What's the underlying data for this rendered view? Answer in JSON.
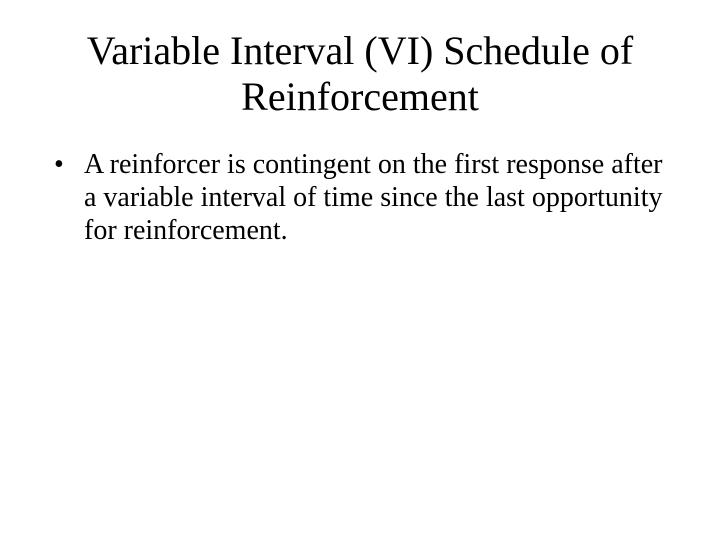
{
  "title": "Variable Interval (VI) Schedule of Reinforcement",
  "bullets": [
    "A reinforcer is contingent on the first response after a variable interval of time since the last opportunity for reinforcement."
  ]
}
